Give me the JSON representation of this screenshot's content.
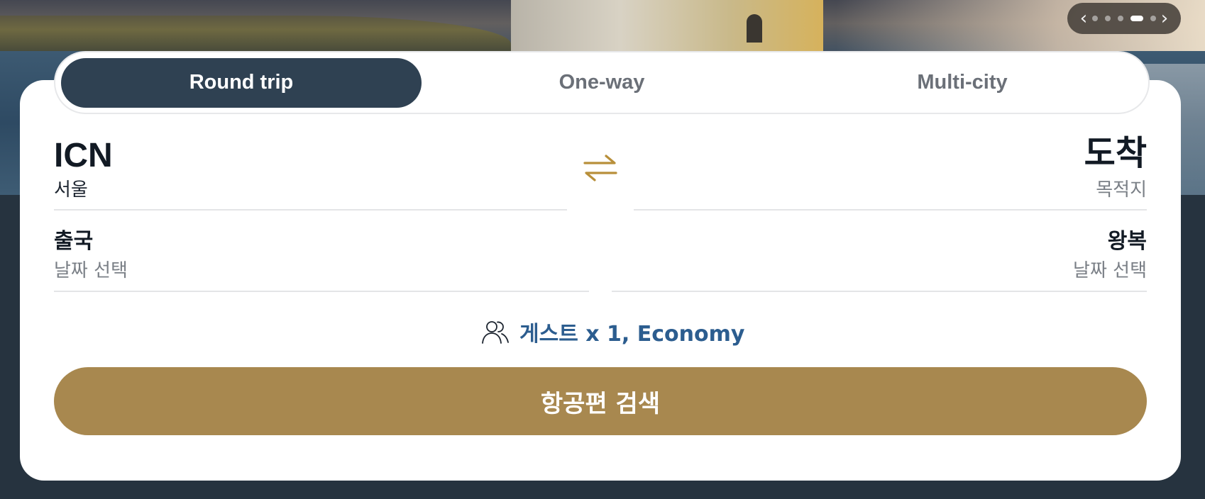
{
  "pager": {
    "prev_label": "‹",
    "next_label": "›",
    "slide_count": 5,
    "active_slide": 4
  },
  "tabs": [
    {
      "label": "Round trip",
      "active": true
    },
    {
      "label": "One-way",
      "active": false
    },
    {
      "label": "Multi-city",
      "active": false
    }
  ],
  "origin": {
    "code": "ICN",
    "city": "서울"
  },
  "destination": {
    "code": "도착",
    "city": "목적지"
  },
  "departure": {
    "label": "출국",
    "value": "날짜 선택"
  },
  "return": {
    "label": "왕복",
    "value": "날짜 선택"
  },
  "guests": {
    "text": "게스트 x 1, Economy"
  },
  "search_button": {
    "label": "항공편 검색"
  },
  "colors": {
    "accent_gold": "#a8884f",
    "active_tab": "#2f4152",
    "guest_link": "#2c5d8f",
    "background": "#26333f"
  }
}
